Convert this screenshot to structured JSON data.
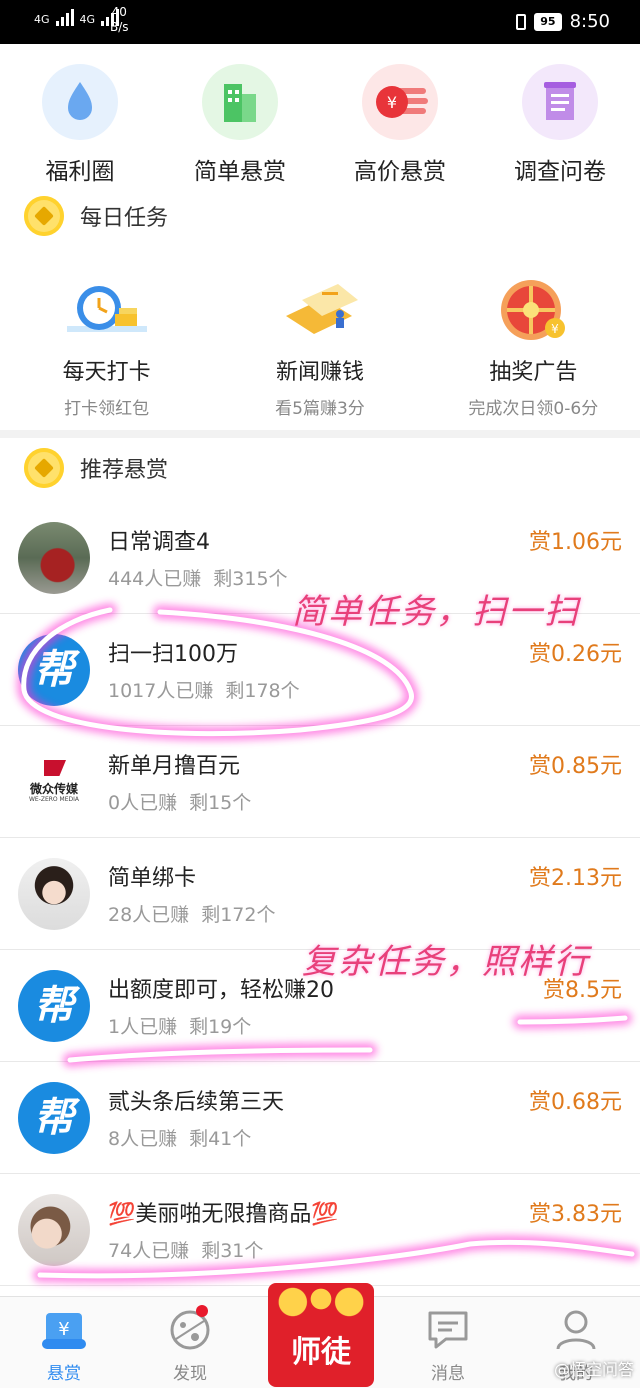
{
  "status_bar": {
    "net1": "4G",
    "net2": "4G",
    "speed_value": "40",
    "speed_unit": "B/s",
    "battery": "95",
    "time": "8:50"
  },
  "quick_grid": [
    {
      "label": "福利圈",
      "icon": "water-drop-icon",
      "color": "#e6f1fd"
    },
    {
      "label": "简单悬赏",
      "icon": "building-icon",
      "color": "#e4f7e4"
    },
    {
      "label": "高价悬赏",
      "icon": "money-bill-icon",
      "color": "#fde7e7"
    },
    {
      "label": "调查问卷",
      "icon": "survey-icon",
      "color": "#f3e8fb"
    }
  ],
  "daily_section": {
    "title": "每日任务"
  },
  "daily_tasks": [
    {
      "title": "每天打卡",
      "sub": "打卡领红包",
      "icon": "alarm-clock-icon"
    },
    {
      "title": "新闻赚钱",
      "sub": "看5篇赚3分",
      "icon": "newspaper-icon"
    },
    {
      "title": "抽奖广告",
      "sub": "完成次日领0-6分",
      "icon": "lottery-wheel-icon"
    }
  ],
  "recommend_section": {
    "title": "推荐悬赏"
  },
  "tasks": [
    {
      "title": "日常调查4",
      "earned": "444人已赚",
      "left": "剩315个",
      "reward": "赏1.06元",
      "avatar": "car"
    },
    {
      "title": "扫一扫100万",
      "earned": "1017人已赚",
      "left": "剩178个",
      "reward": "赏0.26元",
      "avatar": "bang"
    },
    {
      "title": "新单月撸百元",
      "earned": "0人已赚",
      "left": "剩15个",
      "reward": "赏0.85元",
      "avatar": "weizhong"
    },
    {
      "title": "简单绑卡",
      "earned": "28人已赚",
      "left": "剩172个",
      "reward": "赏2.13元",
      "avatar": "kid"
    },
    {
      "title": "出额度即可，轻松赚20",
      "earned": "1人已赚",
      "left": "剩19个",
      "reward": "赏8.5元",
      "avatar": "bang"
    },
    {
      "title": "贰头条后续第三天",
      "earned": "8人已赚",
      "left": "剩41个",
      "reward": "赏0.68元",
      "avatar": "bang"
    },
    {
      "title": "💯美丽啪无限撸商品💯",
      "earned": "74人已赚",
      "left": "剩31个",
      "reward": "赏3.83元",
      "avatar": "girl"
    }
  ],
  "avatar_text": {
    "bang": "帮",
    "weizhong_name": "微众传媒",
    "weizhong_sub": "WE-ZERO MEDIA"
  },
  "annotations": {
    "note1": "简单任务，扫一扫",
    "note2": "复杂任务，照样行",
    "color": "#e8407a"
  },
  "bottom_nav": {
    "items": [
      {
        "label": "悬赏",
        "icon": "scroll-yen-icon",
        "active": true
      },
      {
        "label": "发现",
        "icon": "planet-icon"
      },
      {
        "label": "消息",
        "icon": "chat-bubble-icon"
      },
      {
        "label": "我的",
        "icon": "person-icon"
      }
    ],
    "center_label": "师徒"
  },
  "watermark": "@悟空问答",
  "colors": {
    "reward": "#e07a1c",
    "active": "#2f8bf0",
    "center_red": "#e0202a"
  }
}
